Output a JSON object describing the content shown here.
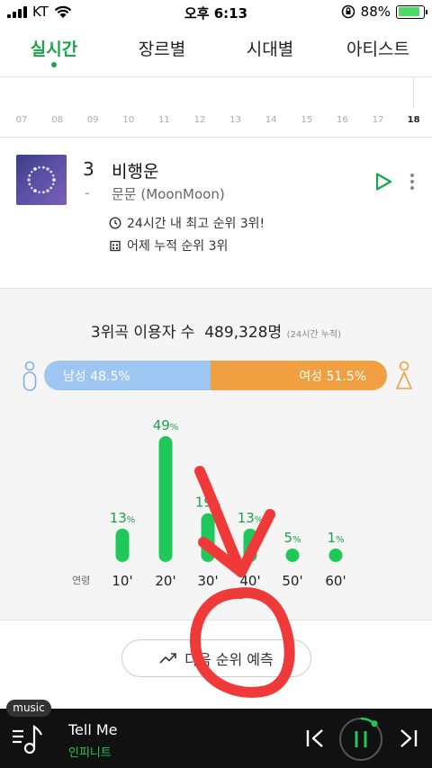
{
  "status_bar": {
    "carrier": "KT",
    "time": "오후 6:13",
    "battery": "88%",
    "battery_level": 0.88
  },
  "tabs": [
    {
      "label": "실시간",
      "active": true
    },
    {
      "label": "장르별",
      "active": false
    },
    {
      "label": "시대별",
      "active": false
    },
    {
      "label": "아티스트",
      "active": false
    }
  ],
  "hour_axis": {
    "labels": [
      "07",
      "08",
      "09",
      "10",
      "11",
      "12",
      "13",
      "14",
      "15",
      "16",
      "17",
      "18"
    ],
    "current": "18"
  },
  "song": {
    "rank": "3",
    "rank_change": "-",
    "title": "비행운",
    "artist": "문문 (MoonMoon)",
    "info_peak": "24시간 내 최고 순위 3위!",
    "info_cumulative": "어제 누적 순위 3위",
    "album_art_icon": "album-art-ring-of-dots",
    "accent": "#1aa34a"
  },
  "stats": {
    "listener_prefix": "3위곡 이용자 수",
    "listener_count": "489,328명",
    "listener_note": "(24시간 누적)",
    "male_label": "남성 48.5%",
    "female_label": "여성 51.5%",
    "male_share": 48.5,
    "female_share": 51.5,
    "male_color": "#9ec6f2",
    "female_color": "#f0a040"
  },
  "chart_data": {
    "type": "bar",
    "xlabel": "연령",
    "categories": [
      "10'",
      "20'",
      "30'",
      "40'",
      "50'",
      "60'"
    ],
    "values": [
      13,
      49,
      19,
      13,
      5,
      1
    ],
    "value_labels": [
      "13%",
      "49%",
      "19%",
      "13%",
      "5%",
      "1%"
    ],
    "unit": "%",
    "color": "#1ec95a",
    "ylim": [
      0,
      49
    ]
  },
  "predict_button": {
    "label": "다음 순위 예측",
    "icon": "trend-up-icon"
  },
  "player": {
    "tag": "music",
    "title": "Tell Me",
    "artist": "인피니트",
    "state": "playing",
    "icons": [
      "playlist-icon",
      "prev-icon",
      "pause-icon",
      "next-icon"
    ]
  },
  "annotation": {
    "color": "#f03a3a",
    "shapes": [
      "arrow",
      "circle"
    ]
  }
}
